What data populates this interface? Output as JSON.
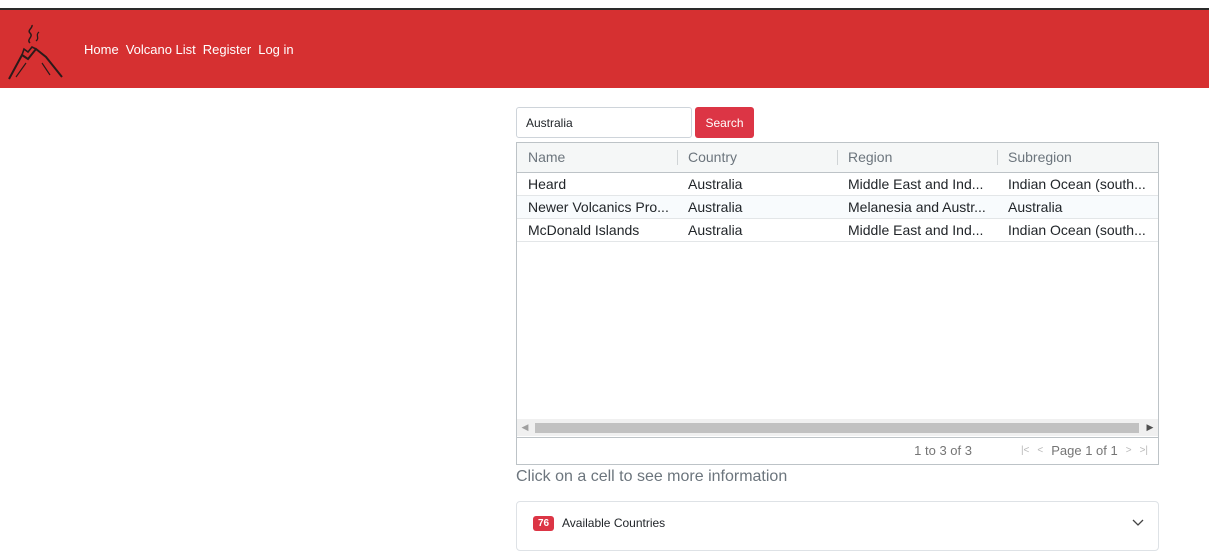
{
  "nav": {
    "logo_icon": "volcano-icon",
    "links": [
      "Home",
      "Volcano List",
      "Register",
      "Log in"
    ]
  },
  "search": {
    "value": "Australia",
    "button_label": "Search"
  },
  "grid": {
    "columns": [
      "Name",
      "Country",
      "Region",
      "Subregion"
    ],
    "rows": [
      [
        "Heard",
        "Australia",
        "Middle East and Ind...",
        "Indian Ocean (south..."
      ],
      [
        "Newer Volcanics Pro...",
        "Australia",
        "Melanesia and Austr...",
        "Australia"
      ],
      [
        "McDonald Islands",
        "Australia",
        "Middle East and Ind...",
        "Indian Ocean (south..."
      ]
    ],
    "summary": "1 to 3 of 3",
    "page_text": "Page 1 of 1"
  },
  "hint": "Click on a cell to see more information",
  "accordion": {
    "badge": "76",
    "label": "Available Countries"
  },
  "colors": {
    "navbar": "#d63031",
    "button": "#dc3545"
  }
}
